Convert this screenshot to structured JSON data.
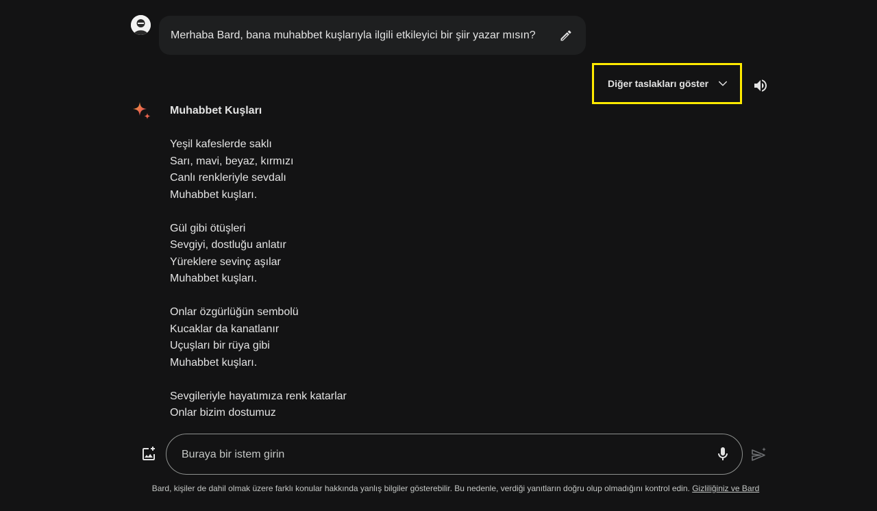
{
  "user_prompt": {
    "text": "Merhaba Bard, bana muhabbet kuşlarıyla ilgili etkileyici bir şiir yazar mısın?",
    "edit_icon": "pencil-icon"
  },
  "drafts": {
    "label": "Diğer taslakları göster",
    "icon": "chevron-down-icon",
    "highlight_color": "#ffea00"
  },
  "speaker_icon": "speaker-icon",
  "response": {
    "icon": "bard-sparkle-icon",
    "title": "Muhabbet Kuşları",
    "stanzas": [
      [
        "Yeşil kafeslerde saklı",
        "Sarı, mavi, beyaz, kırmızı",
        "Canlı renkleriyle sevdalı",
        "Muhabbet kuşları."
      ],
      [
        "Gül gibi ötüşleri",
        "Sevgiyi, dostluğu anlatır",
        "Yüreklere sevinç aşılar",
        "Muhabbet kuşları."
      ],
      [
        "Onlar özgürlüğün sembolü",
        "Kucaklar da kanatlanır",
        "Uçuşları bir rüya gibi",
        "Muhabbet kuşları."
      ],
      [
        "Sevgileriyle hayatımıza renk katarlar",
        "Onlar bizim dostumuz"
      ]
    ]
  },
  "input": {
    "placeholder": "Buraya bir istem girin",
    "value": ""
  },
  "disclaimer": {
    "text": "Bard, kişiler de dahil olmak üzere farklı konular hakkında yanlış bilgiler gösterebilir. Bu nedenle, verdiği yanıtların doğru olup olmadığını kontrol edin.",
    "link_text": "Gizliliğiniz ve Bard"
  },
  "colors": {
    "background": "#131314",
    "bubble": "#1e1f20",
    "text": "#e3e3e3",
    "muted": "#c4c7c5"
  }
}
